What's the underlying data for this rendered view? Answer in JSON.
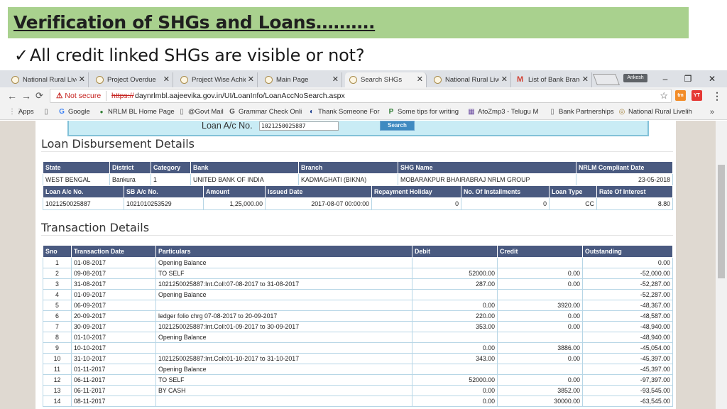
{
  "slide": {
    "title": "Verification of SHGs and Loans……….",
    "bullet": "All credit linked SHGs are visible or not?"
  },
  "browser": {
    "tabs": [
      {
        "label": "National Rural Live"
      },
      {
        "label": "Project Overdue"
      },
      {
        "label": "Project Wise Achie"
      },
      {
        "label": "Main Page"
      },
      {
        "label": "Search SHGs",
        "active": true
      },
      {
        "label": "National Rural Live"
      },
      {
        "label": "List of Bank Branch"
      }
    ],
    "profile_label": "Ankesh",
    "window_controls": {
      "minimize": "–",
      "maximize": "❐",
      "close": "✕"
    },
    "not_secure": "Not secure",
    "url_scheme": "https://",
    "url_rest": "daynrlmbl.aajeevika.gov.in/UI/LoanInfo/LoanAccNoSearch.aspx",
    "extensions": [
      {
        "label": "tm",
        "color": "#f28c28"
      },
      {
        "label": "YT",
        "color": "#e53935"
      }
    ],
    "bookmarks": [
      {
        "label": "Apps",
        "icon": "⋮⋮"
      },
      {
        "label": "Google",
        "icon": "G"
      },
      {
        "label": "NRLM BL Home Page",
        "icon": "●"
      },
      {
        "label": "@Govt Mail",
        "icon": "▯"
      },
      {
        "label": "Grammar Check Onli",
        "icon": "G"
      },
      {
        "label": "Thank Someone For",
        "icon": "◐"
      },
      {
        "label": "Some tips for writing",
        "icon": "P"
      },
      {
        "label": "AtoZmp3 - Telugu M",
        "icon": "▦"
      },
      {
        "label": "Bank Partnerships",
        "icon": "▯"
      },
      {
        "label": "National Rural Livelih",
        "icon": "◎"
      }
    ],
    "bookmarks_more": "»"
  },
  "page": {
    "search": {
      "label": "Loan A/c No.",
      "value": "1021250025887",
      "button": "Search"
    },
    "disbursement_title": "Loan Disbursement Details",
    "disbursement_row1": {
      "headers": [
        "State",
        "District",
        "Category",
        "Bank",
        "Branch",
        "SHG Name",
        "NRLM Compliant Date"
      ],
      "values": [
        "WEST BENGAL",
        "Bankura",
        "1",
        "UNITED BANK OF INDIA",
        "KADMAGHATI (BIKNA)",
        "MOBARAKPUR BHAIRABRAJ NRLM GROUP",
        "23-05-2018"
      ]
    },
    "disbursement_row2": {
      "headers": [
        "Loan A/c No.",
        "SB A/c No.",
        "Amount",
        "Issued Date",
        "Repayment Holiday",
        "No. Of Installments",
        "Loan Type",
        "Rate Of Interest"
      ],
      "values": [
        "1021250025887",
        "1021010253529",
        "1,25,000.00",
        "2017-08-07 00:00:00",
        "0",
        "0",
        "CC",
        "8.80"
      ]
    },
    "transaction_title": "Transaction Details",
    "transactions": {
      "headers": [
        "Sno",
        "Transaction Date",
        "Particulars",
        "Debit",
        "Credit",
        "Outstanding"
      ],
      "rows": [
        [
          "1",
          "01-08-2017",
          "Opening Balance",
          "",
          "",
          "0.00"
        ],
        [
          "2",
          "09-08-2017",
          "TO SELF",
          "52000.00",
          "0.00",
          "-52,000.00"
        ],
        [
          "3",
          "31-08-2017",
          "1021250025887:Int.Coll:07-08-2017 to 31-08-2017",
          "287.00",
          "0.00",
          "-52,287.00"
        ],
        [
          "4",
          "01-09-2017",
          "Opening Balance",
          "",
          "",
          "-52,287.00"
        ],
        [
          "5",
          "06-09-2017",
          "",
          "0.00",
          "3920.00",
          "-48,367.00"
        ],
        [
          "6",
          "20-09-2017",
          "ledger folio chrg 07-08-2017 to 20-09-2017",
          "220.00",
          "0.00",
          "-48,587.00"
        ],
        [
          "7",
          "30-09-2017",
          "1021250025887:Int.Coll:01-09-2017 to 30-09-2017",
          "353.00",
          "0.00",
          "-48,940.00"
        ],
        [
          "8",
          "01-10-2017",
          "Opening Balance",
          "",
          "",
          "-48,940.00"
        ],
        [
          "9",
          "10-10-2017",
          "",
          "0.00",
          "3886.00",
          "-45,054.00"
        ],
        [
          "10",
          "31-10-2017",
          "1021250025887:Int.Coll:01-10-2017 to 31-10-2017",
          "343.00",
          "0.00",
          "-45,397.00"
        ],
        [
          "11",
          "01-11-2017",
          "Opening Balance",
          "",
          "",
          "-45,397.00"
        ],
        [
          "12",
          "06-11-2017",
          "TO SELF",
          "52000.00",
          "0.00",
          "-97,397.00"
        ],
        [
          "13",
          "06-11-2017",
          "BY CASH",
          "0.00",
          "3852.00",
          "-93,545.00"
        ],
        [
          "14",
          "08-11-2017",
          "",
          "0.00",
          "30000.00",
          "-63,545.00"
        ]
      ]
    }
  }
}
